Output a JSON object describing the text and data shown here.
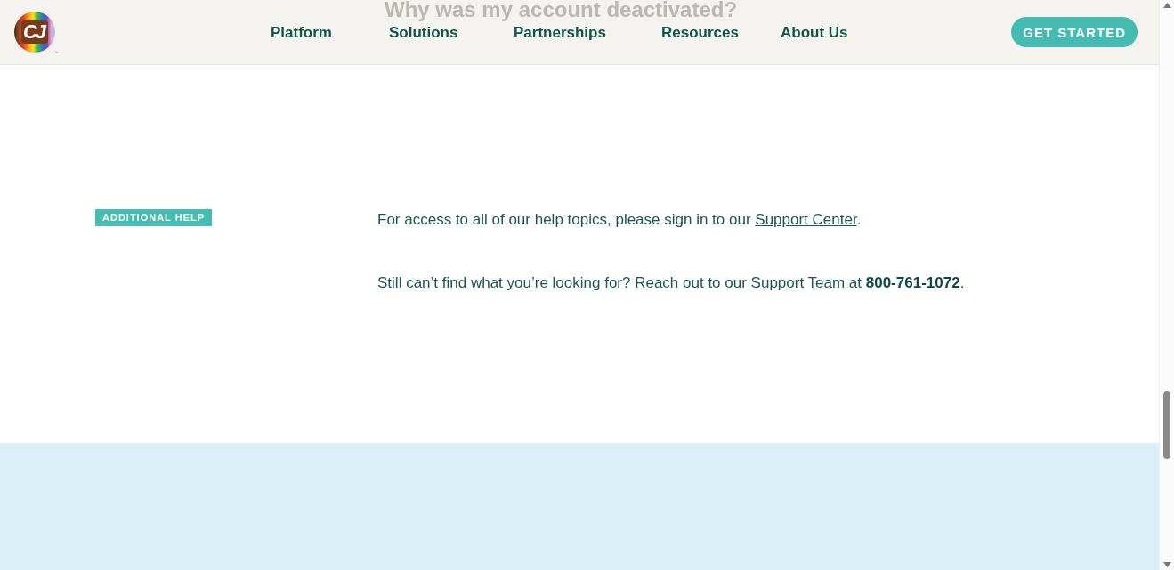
{
  "header": {
    "logo": {
      "text": "CJ",
      "mark": "™"
    },
    "faded_heading": "Why was my account deactivated?",
    "nav": [
      "Platform",
      "Solutions",
      "Partnerships",
      "Resources",
      "About Us"
    ],
    "cta": "GET STARTED"
  },
  "help": {
    "tag": "ADDITIONAL HELP",
    "paragraphs": [
      {
        "kind": "link",
        "before": "For access to all of our help topics, please sign in to our ",
        "link": "Support Center",
        "after": "."
      },
      {
        "kind": "plain",
        "text": "Still can’t find what you’re looking for? Reach out to our Support Team at **800-761-1072**."
      }
    ]
  }
}
